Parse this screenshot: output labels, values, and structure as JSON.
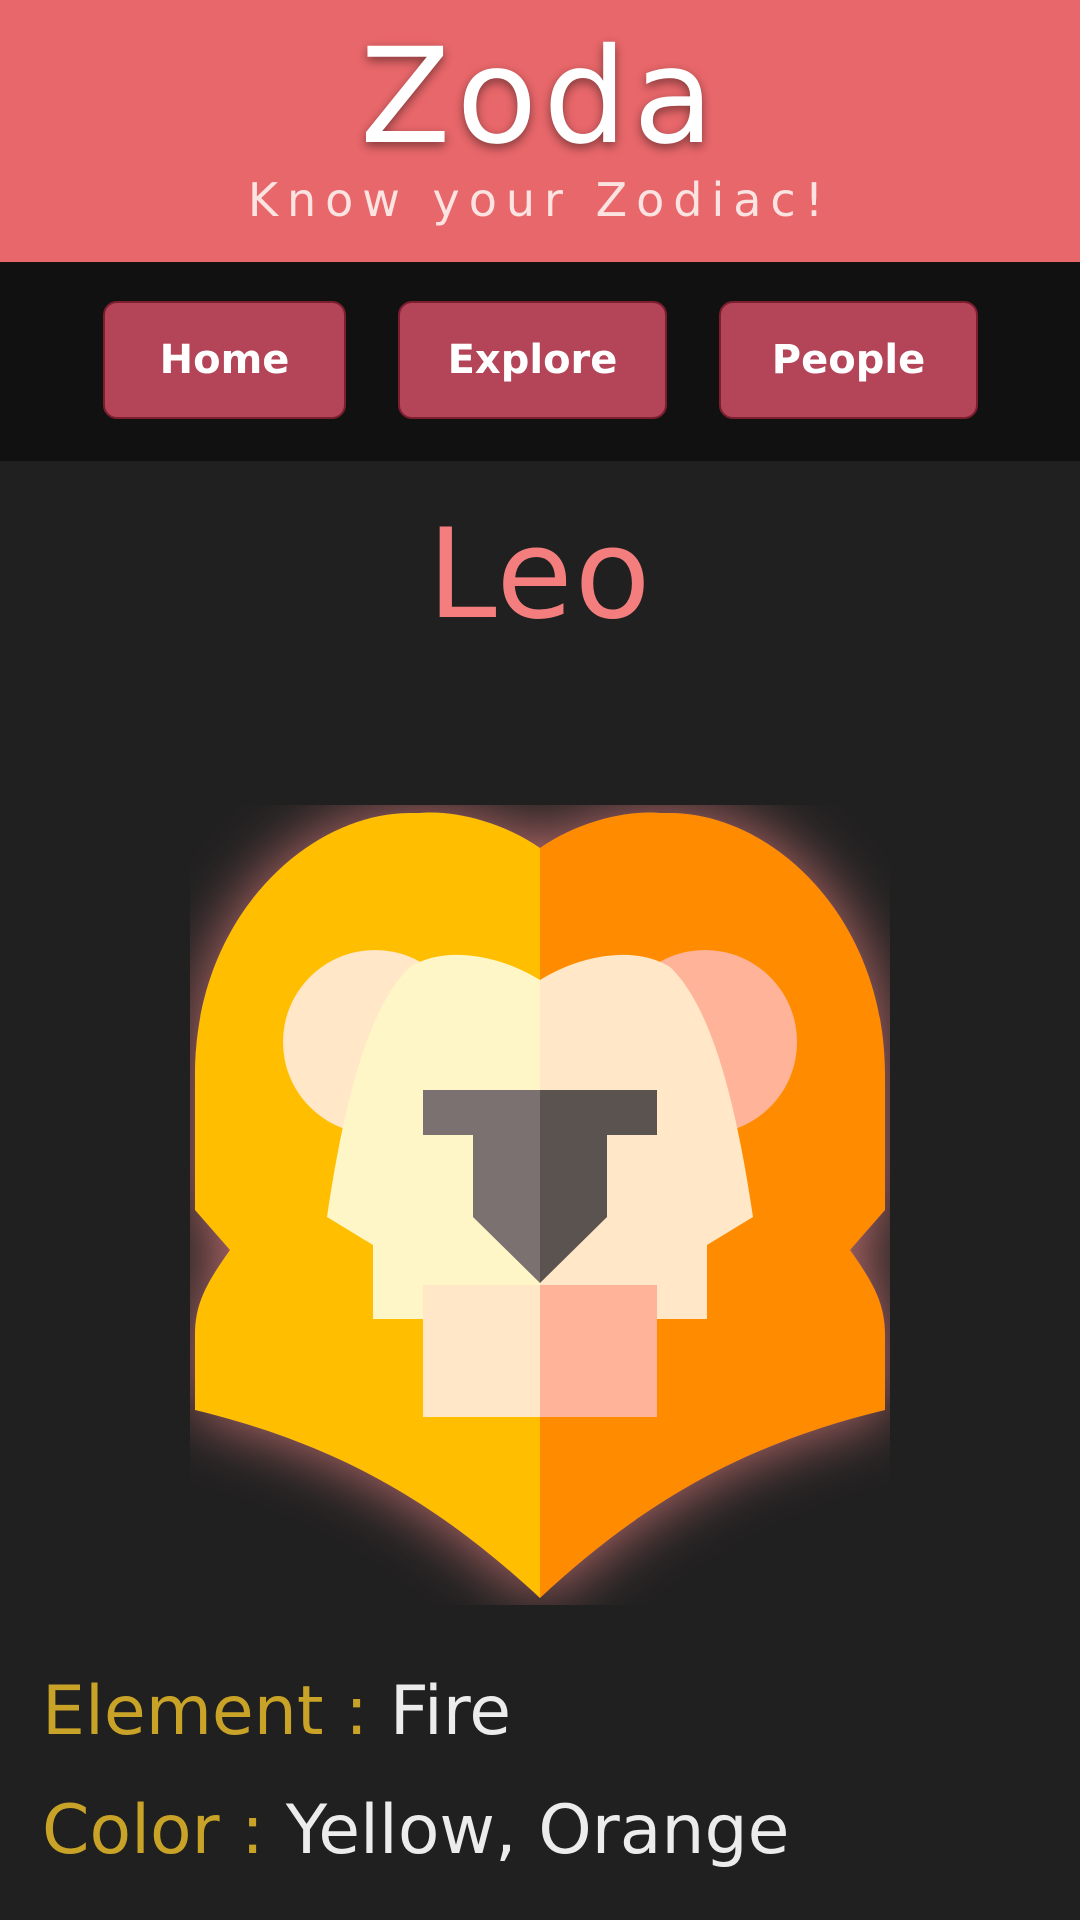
{
  "header": {
    "title": "Zoda",
    "subtitle": "Know your Zodiac!"
  },
  "nav": {
    "items": [
      {
        "label": "Home"
      },
      {
        "label": "Explore"
      },
      {
        "label": "People"
      }
    ]
  },
  "sign": {
    "name": "Leo",
    "icon": "lion-head-icon",
    "element_label": "Element :",
    "element_value": "Fire",
    "color_label": "Color :",
    "color_value": "Yellow, Orange"
  },
  "colors": {
    "header_bg": "#e8676a",
    "nav_bg": "#111111",
    "page_bg": "#202020",
    "button_bg": "#b44457",
    "sign_title": "#f47e7e",
    "label_gold": "#c9a327",
    "lion_yellow": "#ffbe00",
    "lion_orange": "#ff8c00"
  }
}
